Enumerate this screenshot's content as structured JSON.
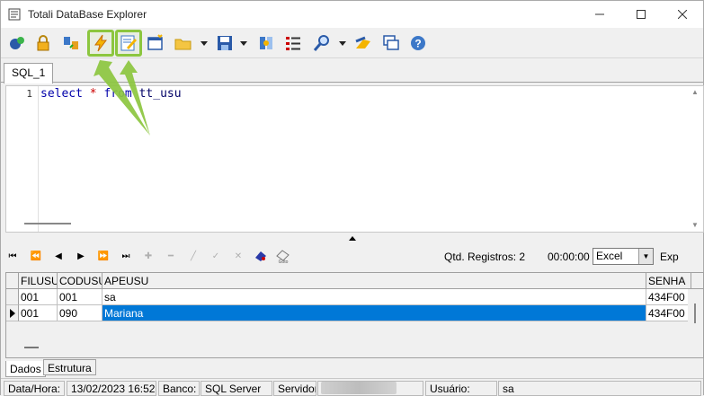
{
  "window": {
    "title": "Totali DataBase Explorer"
  },
  "toolbar": {
    "icons": [
      "connect-icon",
      "lock-icon",
      "refresh-icon",
      "execute-icon",
      "edit-icon",
      "new-window-icon",
      "open-folder-icon",
      "save-icon",
      "properties-icon",
      "list-icon",
      "search-icon",
      "fill-icon",
      "windows-icon",
      "help-icon"
    ],
    "highlight_color": "#8cc63f"
  },
  "sql_tab": {
    "label": "SQL_1"
  },
  "editor": {
    "line_number": "1",
    "tokens": {
      "select": "select",
      "star": "*",
      "from": "from",
      "table": "tt_usu"
    }
  },
  "navigator": {
    "qtd_label": "Qtd. Registros: 2",
    "elapsed": "00:00:00",
    "export_format": "Excel",
    "export_label": "Exp"
  },
  "grid": {
    "columns": [
      "FILUSU",
      "CODUSU",
      "APEUSU",
      "SENHA"
    ],
    "rows": [
      [
        "001",
        "001",
        "sa",
        "434F00"
      ],
      [
        "001",
        "090",
        "Mariana",
        "434F00"
      ]
    ],
    "selection_color": "#0078d7"
  },
  "bottom_tabs": {
    "dados": "Dados",
    "estrutura": "Estrutura"
  },
  "status_bar": {
    "datahora_label": "Data/Hora:",
    "datahora_value": "13/02/2023 16:52:",
    "banco_label": "Banco:",
    "banco_value": "SQL Server",
    "servidor_label": "Servidor:",
    "usuario_label": "Usuário:",
    "usuario_value": "sa"
  }
}
